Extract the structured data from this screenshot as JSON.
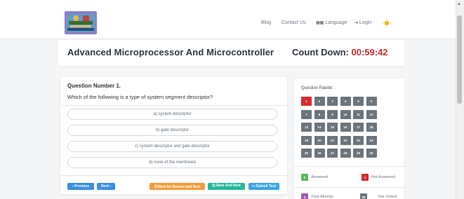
{
  "header": {
    "nav": {
      "blog": "Blog",
      "contact": "Contact Us",
      "language_glyph": "▦▦",
      "language": "Language",
      "login_glyph": "⇥",
      "login": "Login"
    }
  },
  "exam": {
    "title": "Advanced Microprocessor And Microcontroller",
    "countdown_label": "Count Down:",
    "countdown_time": "00:59:42"
  },
  "question": {
    "number_label": "Question Number 1.",
    "text": "Which of the following is a type of system segment descriptor?",
    "options": [
      "a) system descriptor",
      "b) gate descriptor",
      "c) system descriptor and gate descriptor",
      "d) none of the mentioned"
    ]
  },
  "actions": {
    "previous": "‹ Previous",
    "next": "Next ›",
    "mark_review": "⓪Mark for Review and Next",
    "save_next": "🖫 Save And Next",
    "submit": "↪ Submit Test"
  },
  "palette": {
    "title": "Question Palette :",
    "numbers": [
      1,
      2,
      3,
      4,
      5,
      6,
      7,
      8,
      9,
      10,
      11,
      12,
      13,
      14,
      15,
      16,
      17,
      18,
      19,
      20,
      21,
      22,
      23,
      24,
      25,
      26,
      27,
      28,
      29,
      30
    ],
    "current": 1,
    "legend": {
      "answered_count": "0",
      "answered_label": "Answered",
      "not_answered_count": "1",
      "not_answered_label": "Not Answered",
      "total_attempt_count": "0",
      "total_attempt_label": "Total Attempt",
      "not_visited_count": "29",
      "not_visited_label": "Not Visited"
    }
  },
  "colors": {
    "accent_red": "#d62c2c",
    "primary_blue": "#3a8ee6",
    "warning_orange": "#f29c3e",
    "success_green": "#27b89a",
    "info_sky": "#3aa3e3",
    "answered_green": "#5cb85c",
    "attempt_purple": "#9b59b6",
    "not_visited_grey": "#6c757d"
  }
}
